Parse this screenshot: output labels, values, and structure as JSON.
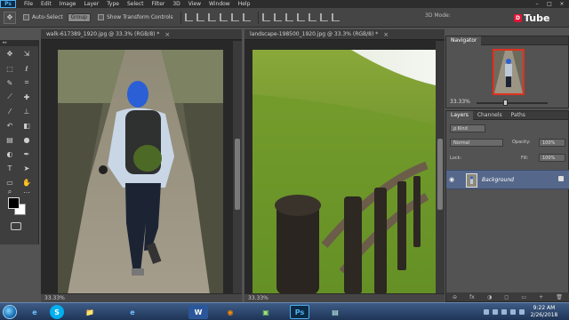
{
  "menubar": {
    "app_logo": "Ps",
    "items": [
      "File",
      "Edit",
      "Image",
      "Layer",
      "Type",
      "Select",
      "Filter",
      "3D",
      "View",
      "Window",
      "Help"
    ],
    "window_controls": [
      "–",
      "□",
      "×"
    ]
  },
  "options": {
    "tool_icon": "move-icon",
    "auto_select_label": "Auto-Select",
    "auto_select_value": "Group",
    "show_transform_label": "Show Transform Controls",
    "mode_3d_label": "3D Mode:"
  },
  "watermark": {
    "badge": "D",
    "text": "Tube"
  },
  "documents": [
    {
      "tab_title": "walk-617389_1920.jpg @ 33.3% (RGB/8) *",
      "zoom_status": "33.33%"
    },
    {
      "tab_title": "landscape-198500_1920.jpg @ 33.3% (RGB/8) *",
      "zoom_status": "33.33%"
    }
  ],
  "navigator": {
    "tab_label": "Navigator",
    "zoom": "33.33%"
  },
  "layers_panel": {
    "tabs": [
      "Layers",
      "Channels",
      "Paths"
    ],
    "kind_label": "ρ Kind",
    "blend_mode": "Normal",
    "opacity_label": "Opacity:",
    "opacity_value": "100%",
    "lock_label": "Lock:",
    "fill_label": "Fill:",
    "fill_value": "100%",
    "layer_name": "Background",
    "footer_icons": [
      "⊖",
      "fx",
      "◑",
      "◻",
      "▭",
      "+",
      "🗑"
    ]
  },
  "taskbar": {
    "apps": [
      "e",
      "S",
      "📁",
      "e",
      "W",
      "◉",
      "▣",
      "Ps",
      "▤"
    ],
    "time": "9:22 AM",
    "date": "2/26/2018"
  },
  "colors": {
    "menu_bg": "#2d2d2d",
    "panel_bg": "#535353",
    "selected_layer": "#55678a",
    "accent": "#e0301e"
  }
}
